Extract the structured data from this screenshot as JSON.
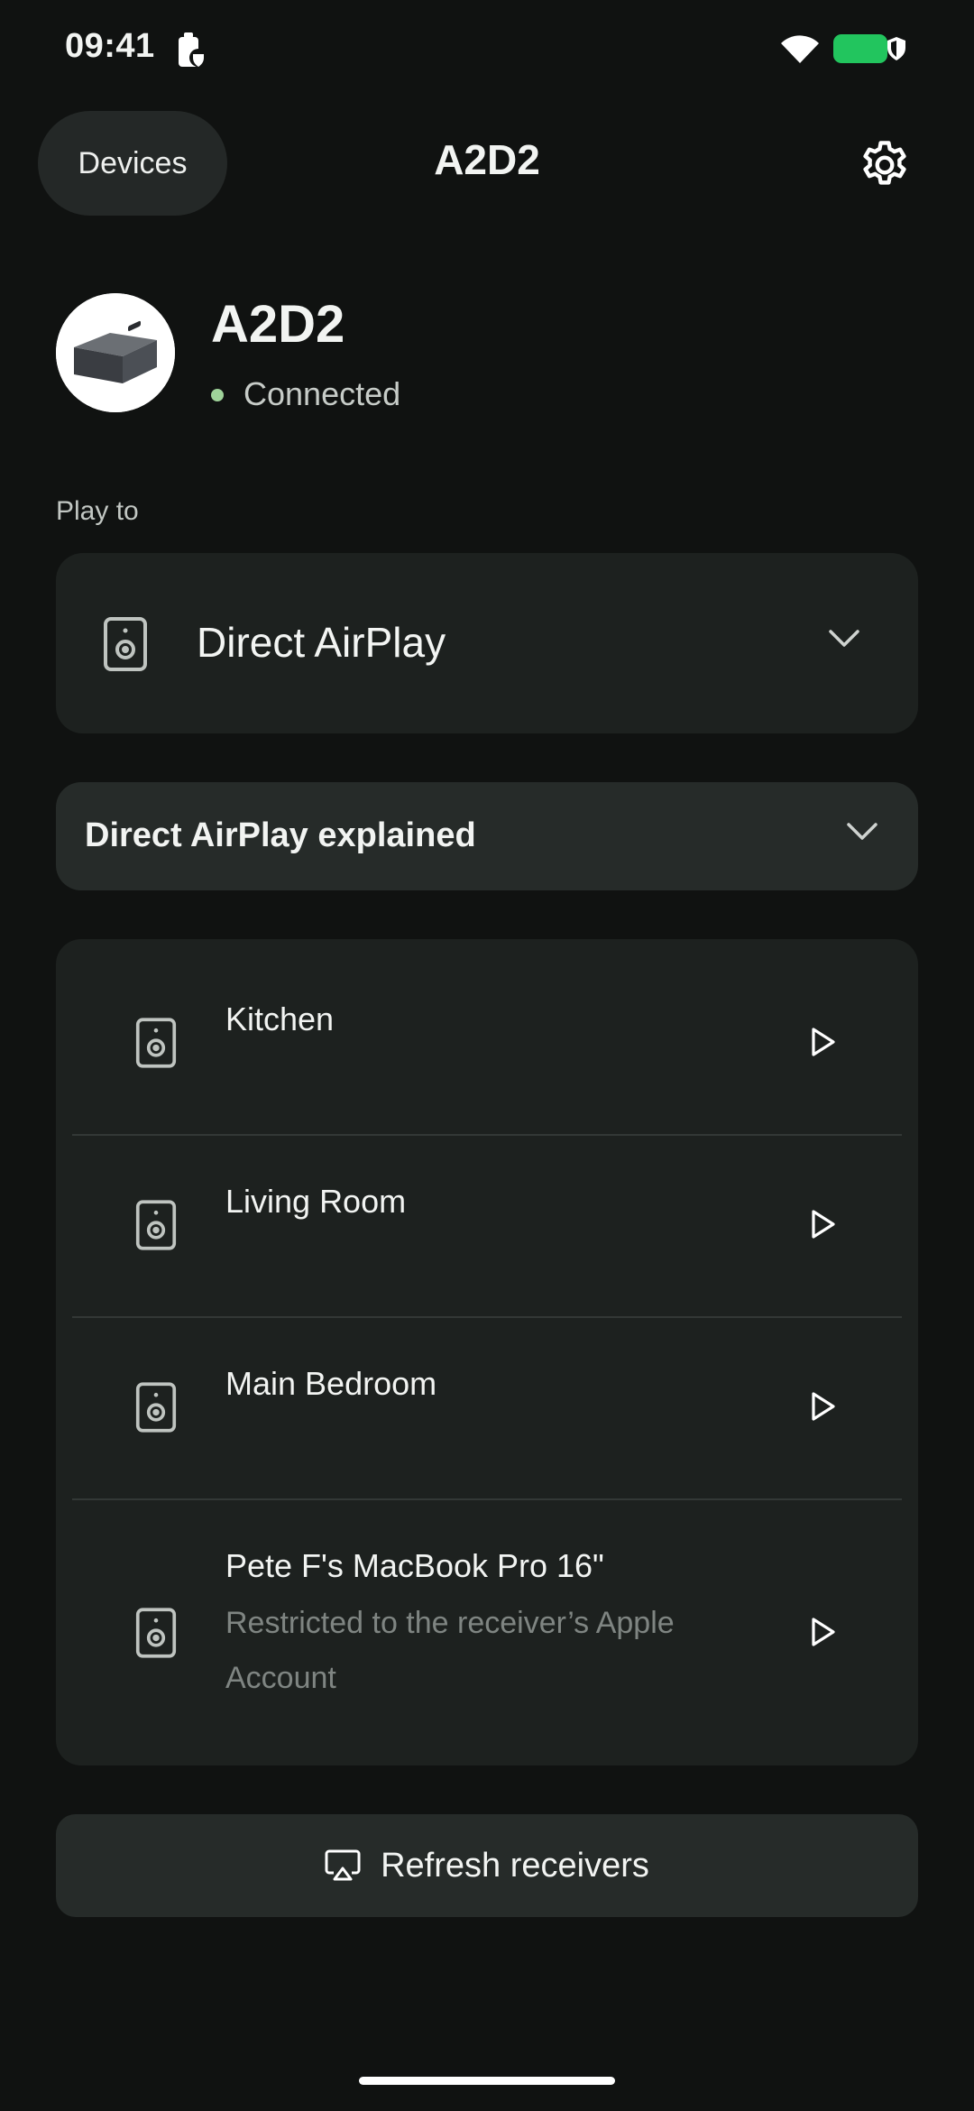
{
  "status_bar": {
    "time": "09:41",
    "icons": [
      "battery-saver-icon",
      "wifi-icon",
      "battery-icon",
      "shield-icon"
    ],
    "battery_color": "#22c55e"
  },
  "header": {
    "back_label": "Devices",
    "title": "A2D2",
    "settings_icon": "gear-icon"
  },
  "device": {
    "name": "A2D2",
    "status": "Connected",
    "status_color": "#9fd39a"
  },
  "play_to": {
    "label": "Play to",
    "selected": "Direct AirPlay",
    "icon": "speaker-icon"
  },
  "explainer": {
    "title": "Direct AirPlay explained",
    "expanded": false
  },
  "receivers": [
    {
      "name": "Kitchen",
      "subtitle": ""
    },
    {
      "name": "Living Room",
      "subtitle": ""
    },
    {
      "name": "Main Bedroom",
      "subtitle": ""
    },
    {
      "name": "Pete F's MacBook Pro 16\"",
      "subtitle": "Restricted to the receiver’s Apple Account"
    }
  ],
  "refresh": {
    "label": "Refresh receivers",
    "icon": "airplay-icon"
  }
}
